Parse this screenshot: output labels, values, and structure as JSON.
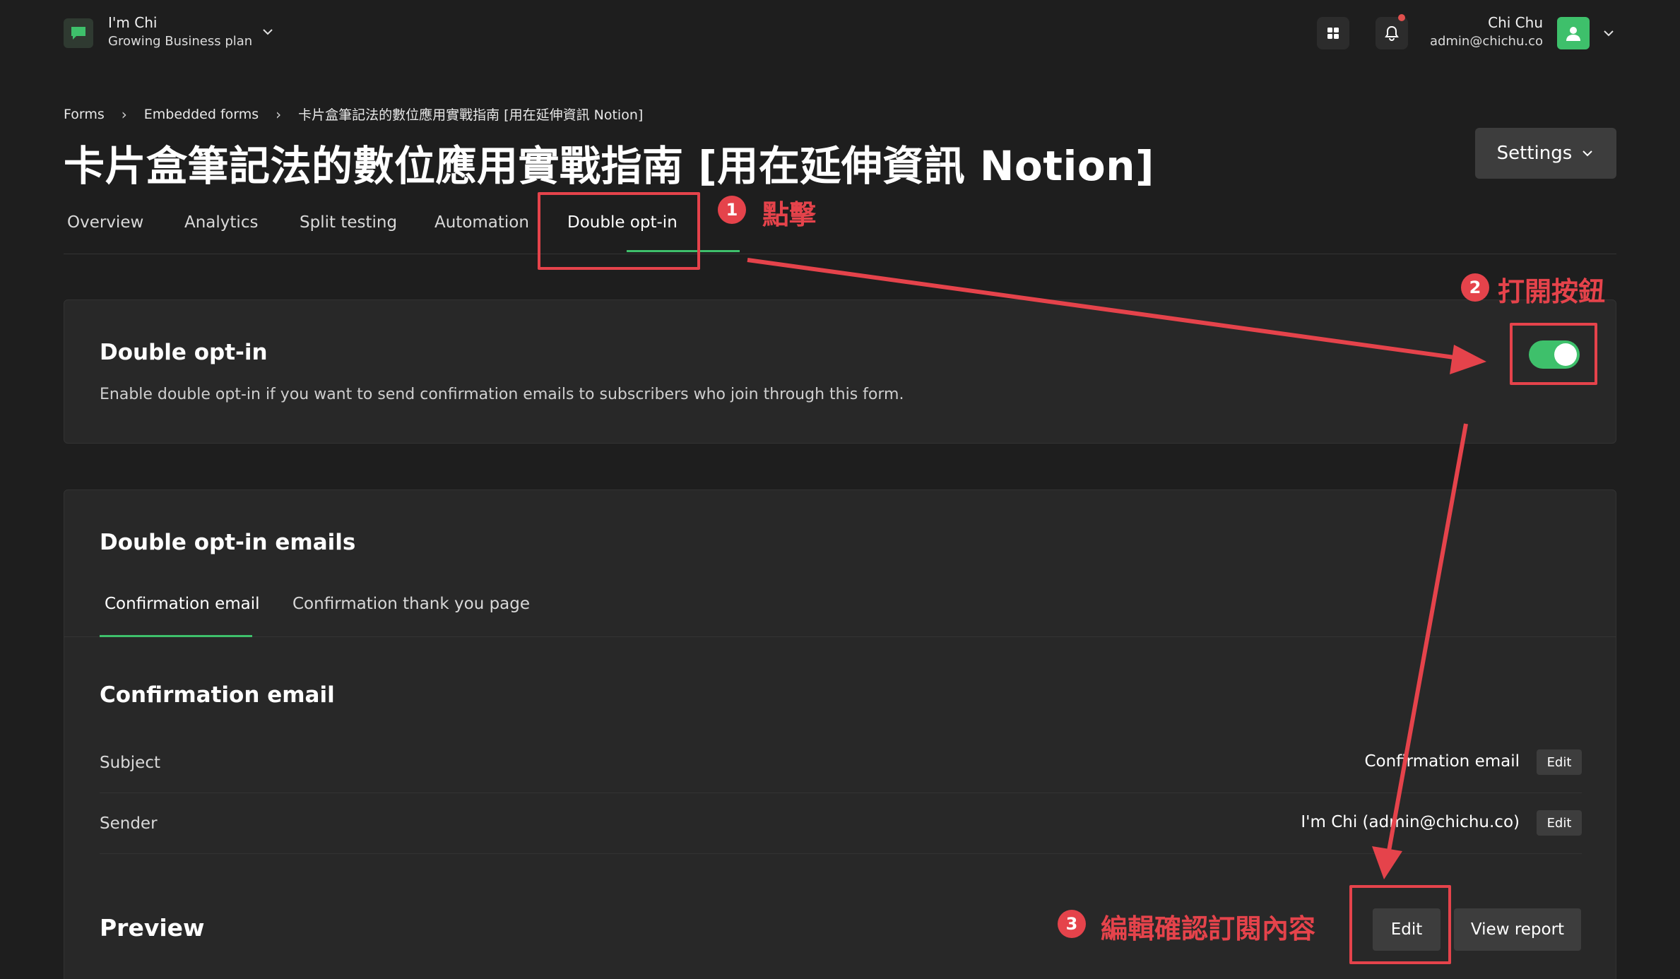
{
  "workspace": {
    "name": "I'm Chi",
    "plan": "Growing Business plan"
  },
  "user": {
    "name": "Chi Chu",
    "email": "admin@chichu.co"
  },
  "breadcrumb": [
    "Forms",
    "Embedded forms",
    "卡片盒筆記法的數位應用實戰指南 [用在延伸資訊 Notion]"
  ],
  "page_title": "卡片盒筆記法的數位應用實戰指南 [用在延伸資訊 Notion]",
  "settings_label": "Settings",
  "tabs": [
    {
      "label": "Overview"
    },
    {
      "label": "Analytics"
    },
    {
      "label": "Split testing"
    },
    {
      "label": "Automation"
    },
    {
      "label": "Double opt-in",
      "active": true
    }
  ],
  "double_opt_in": {
    "title": "Double opt-in",
    "description": "Enable double opt-in if you want to send confirmation emails to subscribers who join through this form.",
    "enabled": true
  },
  "emails_card": {
    "title": "Double opt-in emails",
    "subtabs": [
      {
        "label": "Confirmation email",
        "active": true
      },
      {
        "label": "Confirmation thank you page"
      }
    ],
    "section_title": "Confirmation email",
    "rows": [
      {
        "label": "Subject",
        "value": "Confirmation email",
        "action": "Edit"
      },
      {
        "label": "Sender",
        "value": "I'm Chi (admin@chichu.co)",
        "action": "Edit"
      }
    ],
    "preview_title": "Preview",
    "edit_label": "Edit",
    "view_report_label": "View report"
  },
  "annotations": [
    {
      "number": "1",
      "text": "點擊"
    },
    {
      "number": "2",
      "text": "打開按鈕"
    },
    {
      "number": "3",
      "text": "編輯確認訂閱內容"
    }
  ],
  "colors": {
    "accent": "#3ec06b",
    "annotation": "#e5434b",
    "background": "#1e1e1e",
    "card": "#282828"
  }
}
